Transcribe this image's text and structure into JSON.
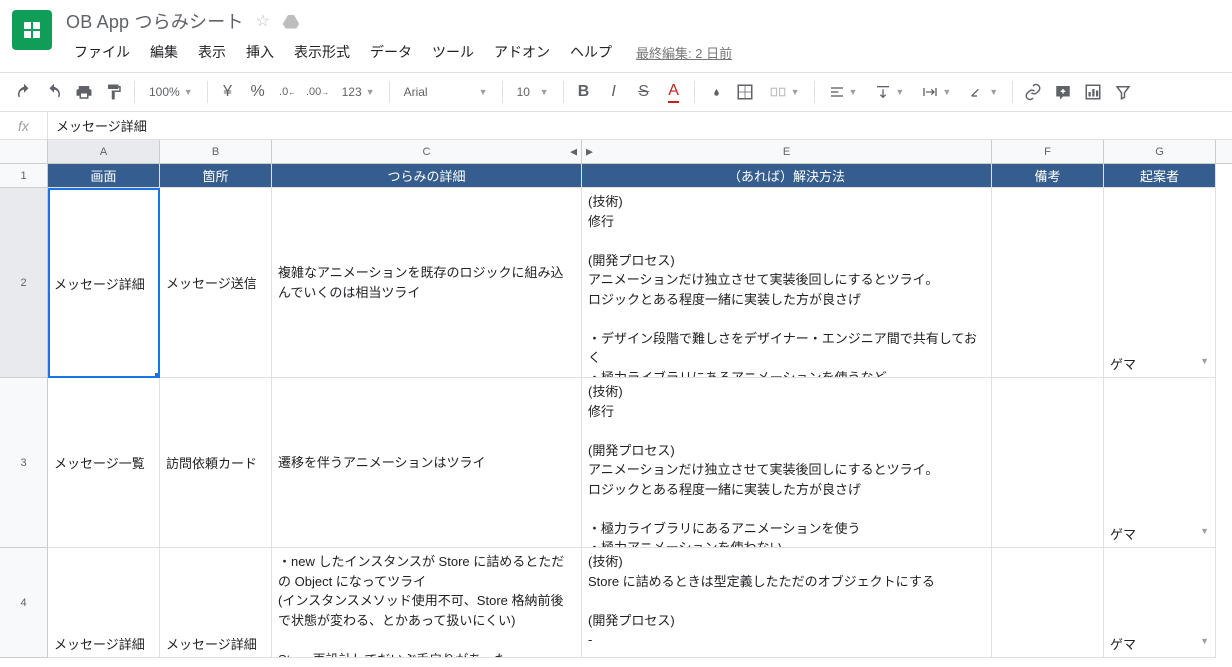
{
  "doc": {
    "title": "OB App つらみシート",
    "last_edit": "最終編集: 2 日前"
  },
  "menu": {
    "file": "ファイル",
    "edit": "編集",
    "view": "表示",
    "insert": "挿入",
    "format": "表示形式",
    "data": "データ",
    "tools": "ツール",
    "addons": "アドオン",
    "help": "ヘルプ"
  },
  "toolbar": {
    "zoom": "100%",
    "currency": "¥",
    "percent": "%",
    "dec_dec": ".0",
    "inc_dec": ".00",
    "numfmt": "123",
    "font": "Arial",
    "size": "10"
  },
  "fx": {
    "value": "メッセージ詳細"
  },
  "cols": {
    "A": "A",
    "B": "B",
    "C": "C",
    "E": "E",
    "F": "F",
    "G": "G"
  },
  "row_nums": {
    "r1": "1",
    "r2": "2",
    "r3": "3",
    "r4": "4"
  },
  "headers": {
    "A": "画面",
    "B": "箇所",
    "C": "つらみの詳細",
    "E": "（あれば）解決方法",
    "F": "備考",
    "G": "起案者"
  },
  "r2": {
    "A": "メッセージ詳細",
    "B": "メッセージ送信",
    "C": "複雑なアニメーションを既存のロジックに組み込んでいくのは相当ツライ",
    "E": "(技術)\n修行\n\n(開発プロセス)\nアニメーションだけ独立させて実装後回しにするとツライ。\nロジックとある程度一緒に実装した方が良さげ\n\n・デザイン段階で難しさをデザイナー・エンジニア間で共有しておく\n・極力ライブラリにあるアニメーションを使うなど",
    "G": "ゲマ"
  },
  "r3": {
    "A": "メッセージ一覧",
    "B": "訪問依頼カード",
    "C": "遷移を伴うアニメーションはツライ",
    "E": "(技術)\n修行\n\n(開発プロセス)\nアニメーションだけ独立させて実装後回しにするとツライ。\nロジックとある程度一緒に実装した方が良さげ\n\n・極力ライブラリにあるアニメーションを使う\n・極力アニメーションを使わない",
    "G": "ゲマ"
  },
  "r4": {
    "A": "メッセージ詳細",
    "B": "メッセージ詳細",
    "C": "・new したインスタンスが Store に詰めるとただの Object になってツライ\n(インスタンスメソッド使用不可、Store 格納前後で状態が変わる、とかあって扱いにくい)\n\nStore 再設計してだいぶ手戻りがあった",
    "E": "(技術)\nStore に詰めるときは型定義したただのオブジェクトにする\n\n(開発プロセス)\n-",
    "G": "ゲマ"
  }
}
